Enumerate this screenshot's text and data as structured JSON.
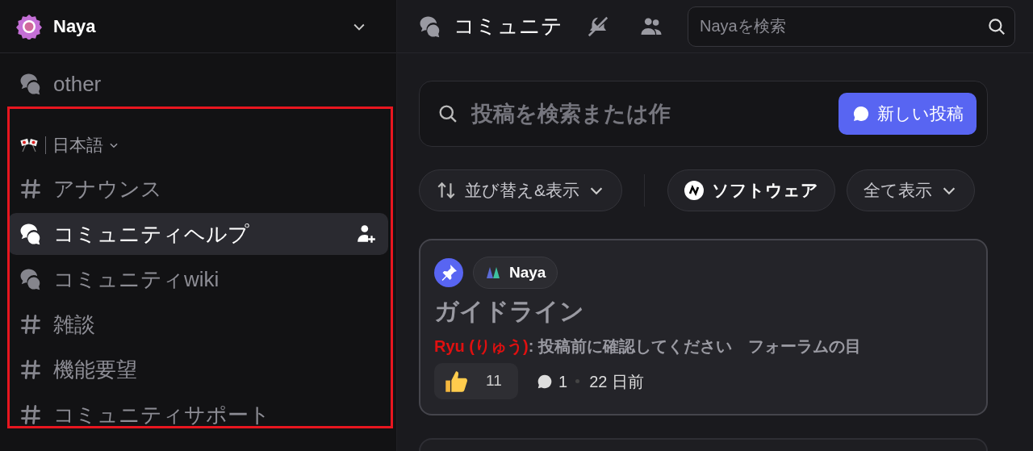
{
  "server": {
    "name": "Naya"
  },
  "sidebar": {
    "items": [
      {
        "kind": "forum",
        "label": "other",
        "selected": false
      },
      {
        "kind": "category",
        "label": "日本語"
      },
      {
        "kind": "text",
        "label": "アナウンス",
        "selected": false
      },
      {
        "kind": "forum",
        "label": "コミュニティヘルプ",
        "selected": true
      },
      {
        "kind": "forum",
        "label": "コミュニティwiki",
        "selected": false
      },
      {
        "kind": "text",
        "label": "雑談",
        "selected": false
      },
      {
        "kind": "text",
        "label": "機能要望",
        "selected": false
      },
      {
        "kind": "text",
        "label": "コミュニティサポート",
        "selected": false
      }
    ]
  },
  "header": {
    "title": "コミュニテ",
    "search": {
      "placeholder": "Nayaを検索"
    }
  },
  "forum": {
    "search": {
      "placeholder": "投稿を検索または作"
    },
    "new_post_button": "新しい投稿",
    "filters": [
      {
        "kind": "sort",
        "label": "並び替え&表示"
      },
      {
        "kind": "tag",
        "label": "ソフトウェア"
      },
      {
        "kind": "dropdown",
        "label": "全て表示"
      }
    ],
    "posts": [
      {
        "pinned": true,
        "tag": "Naya",
        "title": "ガイドライン",
        "author": "Ryu (りゅう)",
        "preview": ": 投稿前に確認してください　フォーラムの目",
        "reaction_count": "11",
        "comment_count": "1",
        "age": "22 日前"
      }
    ]
  }
}
